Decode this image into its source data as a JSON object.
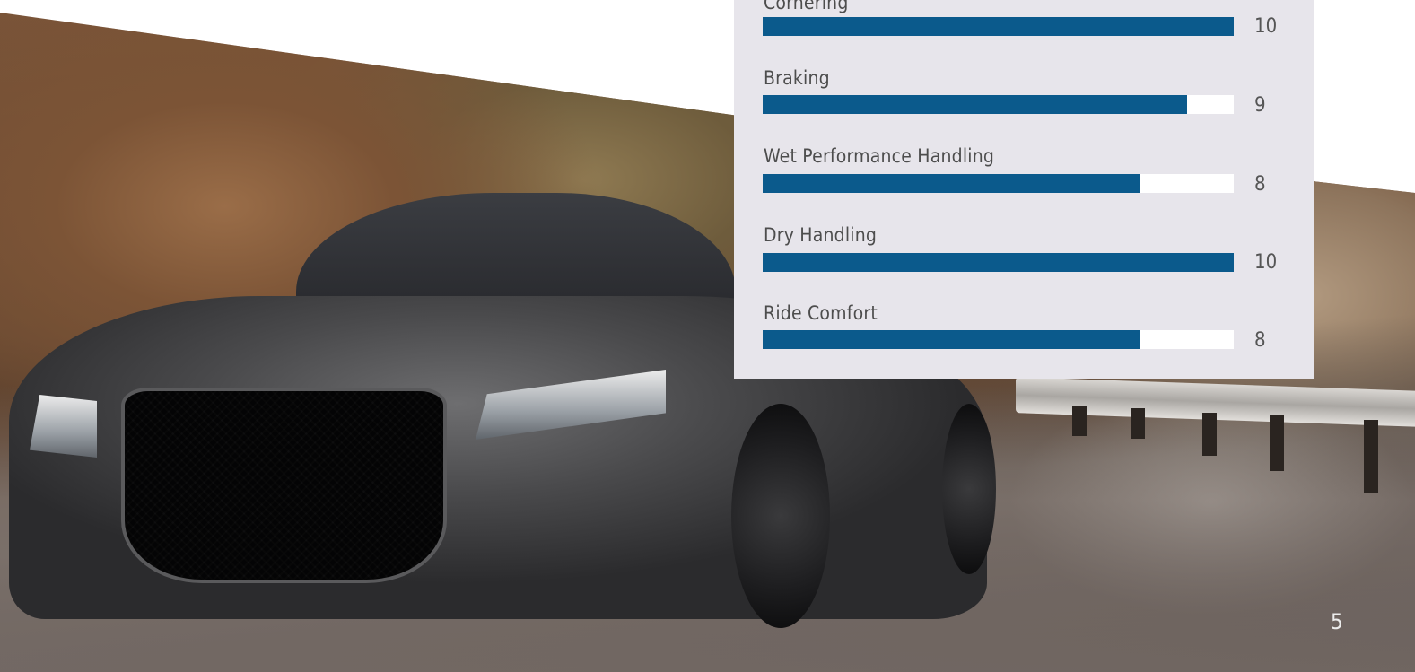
{
  "colors": {
    "panel_background": "#e7e5eb",
    "bar_fill": "#0b5a8c",
    "bar_track": "#ffffff"
  },
  "ratings": {
    "max": 10,
    "items": [
      {
        "label": "Cornering",
        "value": "10"
      },
      {
        "label": "Braking",
        "value": "9"
      },
      {
        "label": "Wet Performance Handling",
        "value": "8"
      },
      {
        "label": "Dry Handling",
        "value": "10"
      },
      {
        "label": "Ride Comfort",
        "value": "8"
      }
    ]
  },
  "page_number": "5"
}
